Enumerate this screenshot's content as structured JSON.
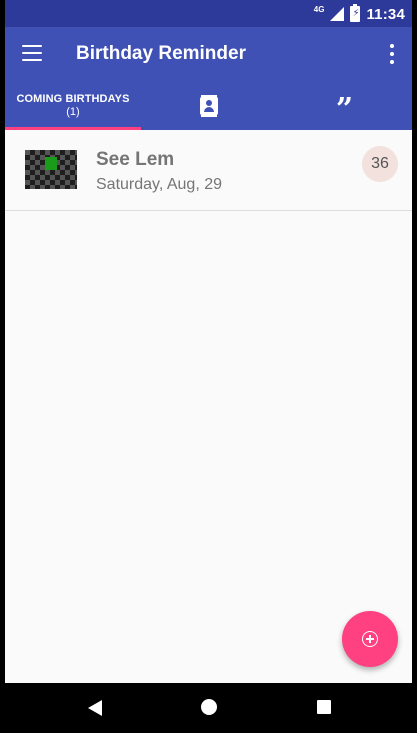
{
  "status_bar": {
    "network": "4G",
    "time": "11:34"
  },
  "app_bar": {
    "title": "Birthday Reminder",
    "menu_icon": "hamburger-menu-icon",
    "more_icon": "more-vert-icon"
  },
  "tabs": [
    {
      "label": "COMING BIRTHDAYS",
      "count": "(1)",
      "selected": true
    },
    {
      "icon": "contacts-icon",
      "selected": false
    },
    {
      "icon": "quote-icon",
      "selected": false
    }
  ],
  "birthdays": [
    {
      "name": "See Lem",
      "date": "Saturday, Aug,  29",
      "age": "36"
    }
  ],
  "fab": {
    "icon": "add-circle-icon"
  },
  "colors": {
    "primary": "#3f51b5",
    "primary_dark": "#2e3a99",
    "accent": "#ff4081",
    "badge": "#f2e1dc"
  }
}
